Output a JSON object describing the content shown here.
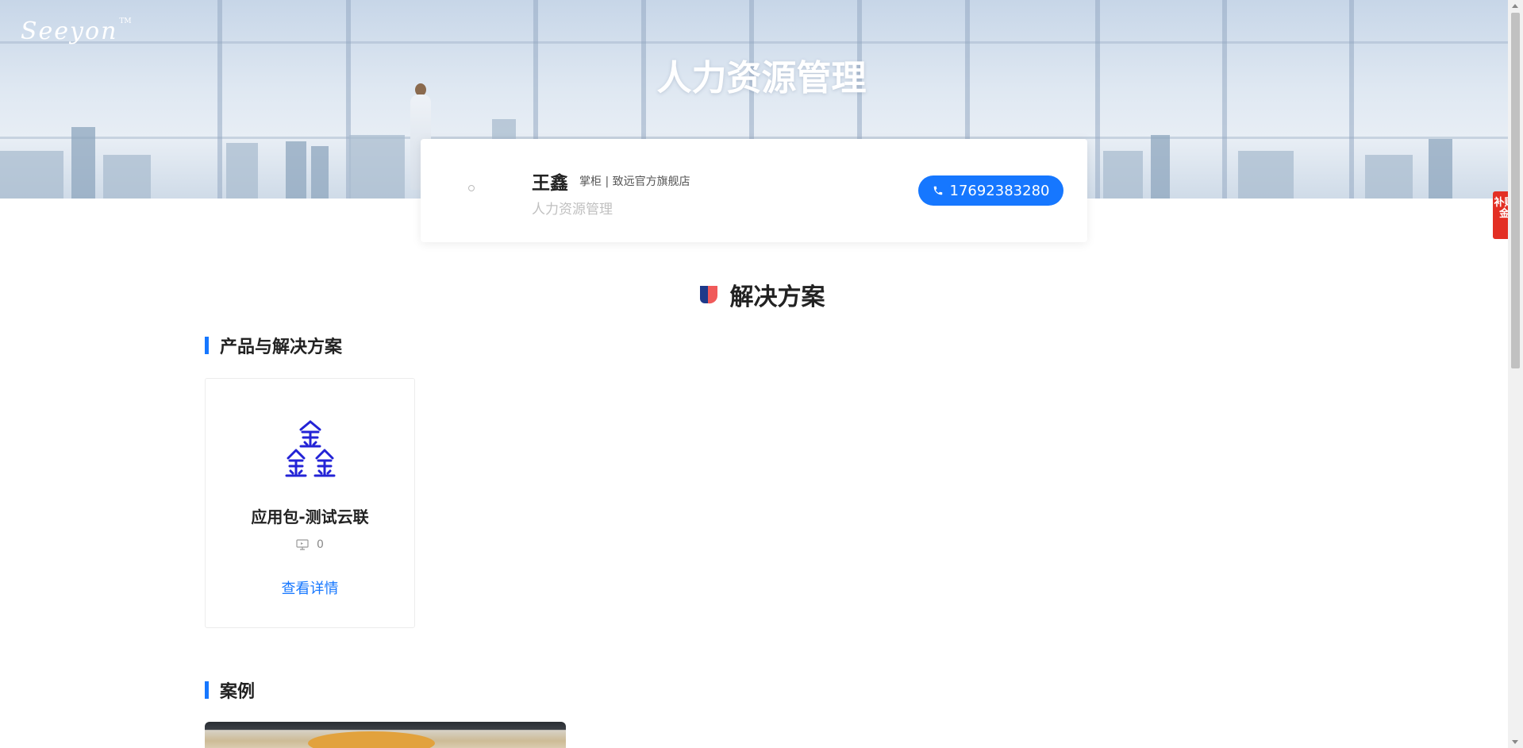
{
  "hero": {
    "logo": "Seeyon",
    "logo_tm": "TM",
    "title": "人力资源管理"
  },
  "contact": {
    "name": "王鑫",
    "role": "掌柜 | 致远官方旗舰店",
    "subtitle": "人力资源管理",
    "phone": "17692383280"
  },
  "section": {
    "title": "解决方案"
  },
  "products_section": {
    "title": "产品与解决方案",
    "items": [
      {
        "name": "应用包-测试云联",
        "views": "0",
        "detail_label": "查看详情"
      }
    ]
  },
  "cases_section": {
    "title": "案例"
  },
  "side_widget": {
    "label": "补贴金"
  },
  "colors": {
    "accent": "#1677ff",
    "subsidy": "#e32f24"
  }
}
